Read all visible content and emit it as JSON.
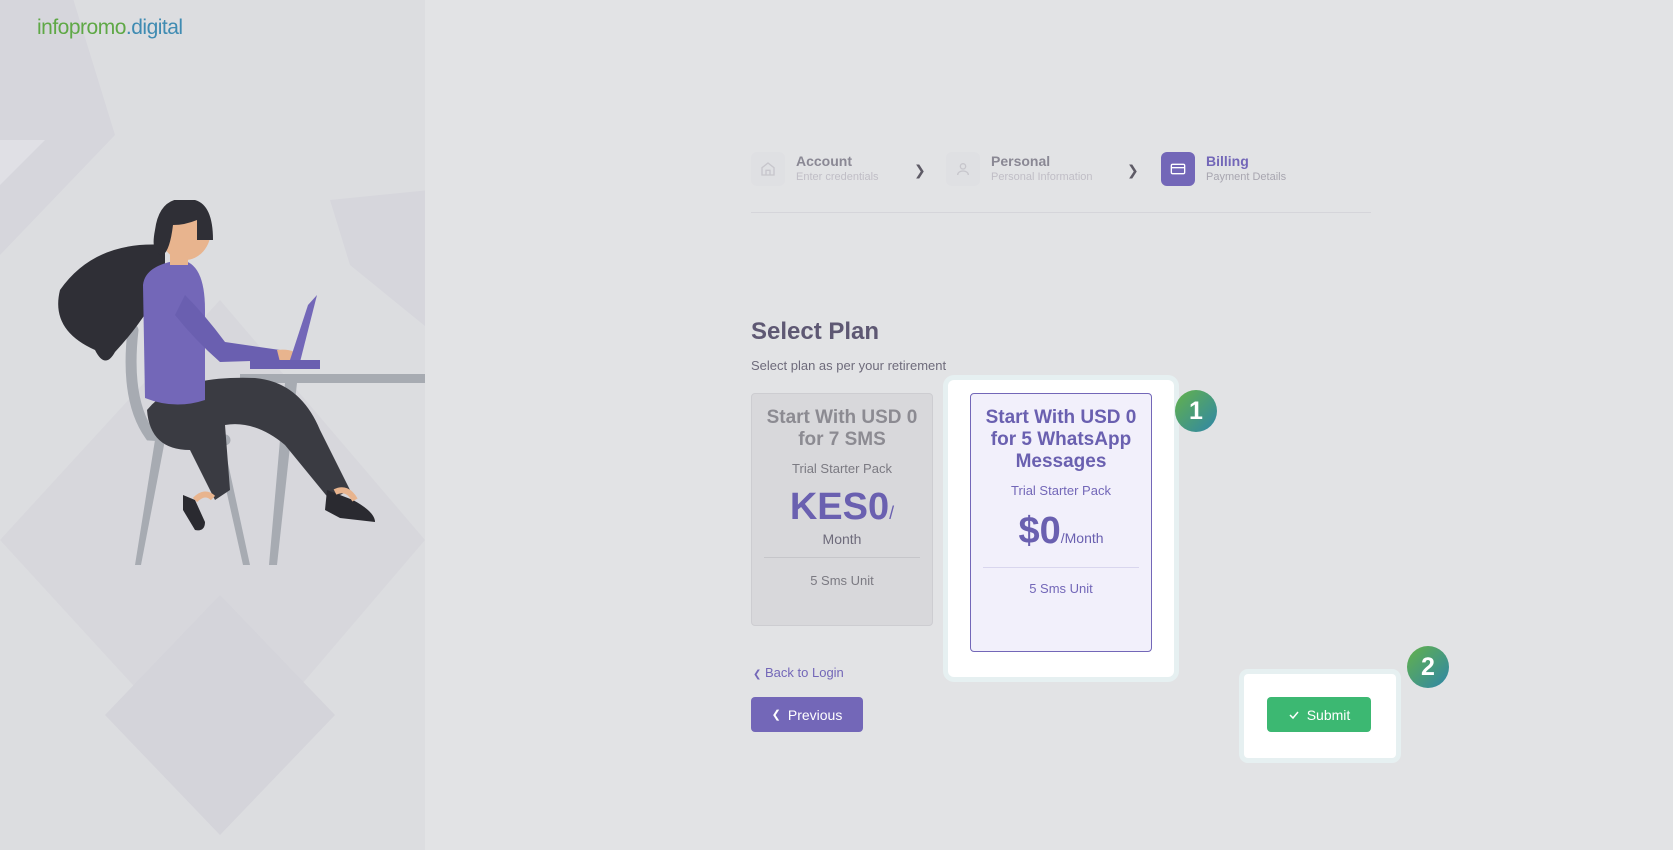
{
  "brand": {
    "logo_part1": "infopromo",
    "logo_part2": ".digital",
    "colors": {
      "green": "#5fa846",
      "blue": "#3f8bb2"
    }
  },
  "illustration": {
    "name": "woman-working-on-laptop-illustration"
  },
  "stepper": {
    "steps": [
      {
        "title": "Account",
        "subtitle": "Enter credentials",
        "icon": "home-icon",
        "active": false
      },
      {
        "title": "Personal",
        "subtitle": "Personal Information",
        "icon": "user-icon",
        "active": false
      },
      {
        "title": "Billing",
        "subtitle": "Payment Details",
        "icon": "credit-card-icon",
        "active": true
      }
    ],
    "separator_icon": "chevron-right-icon"
  },
  "section": {
    "title": "Select Plan",
    "subtitle": "Select plan as per your retirement"
  },
  "plans": [
    {
      "title": "Start With USD 0 for 7 SMS",
      "tag": "Trial Starter Pack",
      "price": "KES0",
      "per": "/",
      "period": "Month",
      "units": "5 Sms Unit",
      "selected": false
    },
    {
      "title": "Start With USD 0 for 5 WhatsApp Messages",
      "tag": "Trial Starter Pack",
      "price": "$0",
      "per": "/Month",
      "units": "5 Sms Unit",
      "selected": true
    }
  ],
  "markers": {
    "one": "1",
    "two": "2"
  },
  "nav": {
    "back_label": "Back to Login",
    "previous_label": "Previous",
    "submit_label": "Submit"
  },
  "colors": {
    "primary": "#7367b8",
    "success": "#3cb872"
  }
}
